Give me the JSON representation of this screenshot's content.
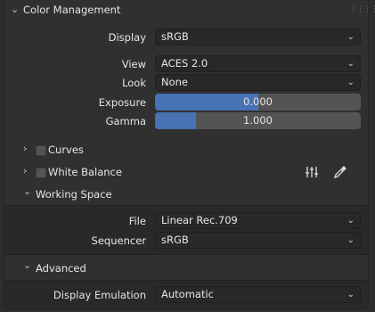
{
  "color_management": {
    "title": "Color Management",
    "display": {
      "label": "Display",
      "value": "sRGB"
    },
    "view": {
      "label": "View",
      "value": "ACES 2.0"
    },
    "look": {
      "label": "Look",
      "value": "None"
    },
    "exposure": {
      "label": "Exposure",
      "value": "0.000",
      "fill": 0.5
    },
    "gamma": {
      "label": "Gamma",
      "value": "1.000",
      "fill": 0.2
    }
  },
  "curves": {
    "label": "Curves"
  },
  "white_balance": {
    "label": "White Balance",
    "icons": [
      "sliders-icon",
      "eyedropper-icon"
    ]
  },
  "working_space": {
    "title": "Working Space",
    "file": {
      "label": "File",
      "value": "Linear Rec.709"
    },
    "sequencer": {
      "label": "Sequencer",
      "value": "sRGB"
    }
  },
  "advanced": {
    "title": "Advanced",
    "display_emulation": {
      "label": "Display Emulation",
      "value": "Automatic"
    }
  }
}
